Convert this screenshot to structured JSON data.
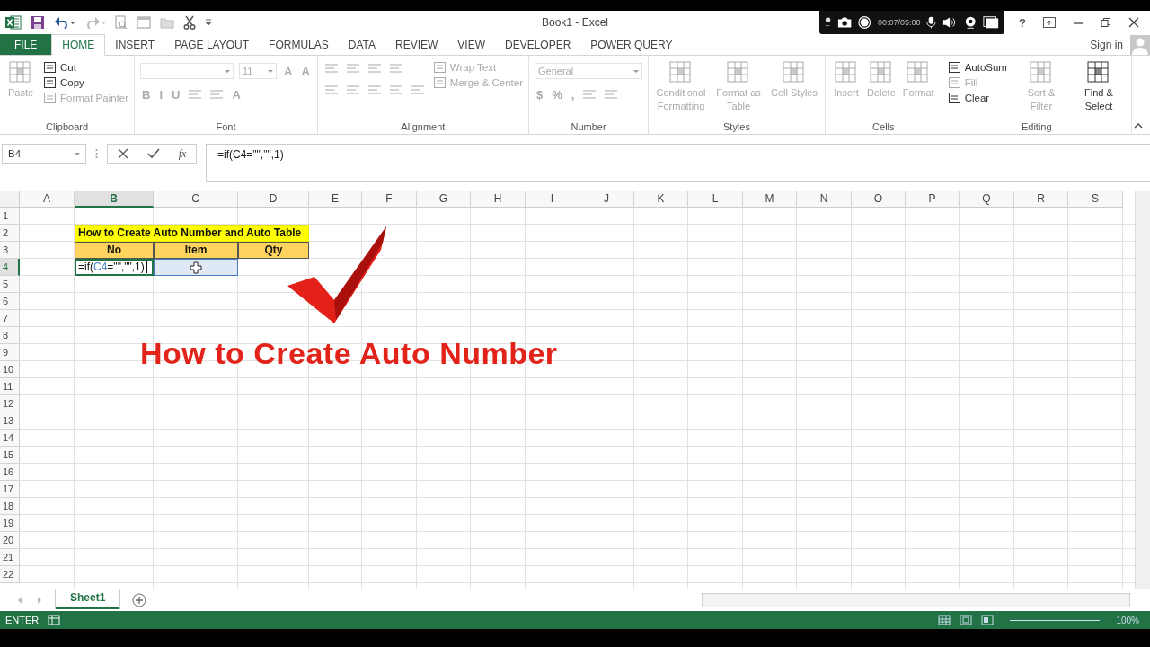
{
  "title_bar": {
    "title": "Book1 - Excel",
    "help": "?"
  },
  "recorder": {
    "time": "00:07/05:00"
  },
  "tabs": [
    {
      "label": "FILE",
      "kind": "file",
      "selected": false
    },
    {
      "label": "HOME",
      "kind": "tab",
      "selected": true
    },
    {
      "label": "INSERT",
      "kind": "tab",
      "selected": false
    },
    {
      "label": "PAGE LAYOUT",
      "kind": "tab",
      "selected": false
    },
    {
      "label": "FORMULAS",
      "kind": "tab",
      "selected": false
    },
    {
      "label": "DATA",
      "kind": "tab",
      "selected": false
    },
    {
      "label": "REVIEW",
      "kind": "tab",
      "selected": false
    },
    {
      "label": "VIEW",
      "kind": "tab",
      "selected": false
    },
    {
      "label": "DEVELOPER",
      "kind": "tab",
      "selected": false
    },
    {
      "label": "POWER QUERY",
      "kind": "tab",
      "selected": false
    }
  ],
  "sign_in": "Sign in",
  "ribbon": {
    "groups": [
      {
        "label": "Clipboard",
        "sections": [
          {
            "kind": "large",
            "items": [
              {
                "label": "Paste",
                "disabled": true
              }
            ]
          },
          {
            "kind": "stack",
            "items": [
              {
                "label": "Cut",
                "disabled": false
              },
              {
                "label": "Copy",
                "disabled": false
              },
              {
                "label": "Format Painter",
                "disabled": true
              }
            ]
          }
        ]
      },
      {
        "label": "Font",
        "sections": [
          {
            "kind": "rows",
            "rows": [
              [
                {
                  "kind": "fontbox",
                  "disabled": true
                },
                {
                  "kind": "sizebox",
                  "value": "11",
                  "disabled": true
                },
                {
                  "kind": "glyph",
                  "value": "A",
                  "disabled": true
                },
                {
                  "kind": "glyph",
                  "value": "A",
                  "disabled": true
                }
              ],
              [
                {
                  "kind": "glyph",
                  "value": "B",
                  "disabled": true
                },
                {
                  "kind": "glyph",
                  "value": "I",
                  "disabled": true
                },
                {
                  "kind": "glyph",
                  "value": "U",
                  "disabled": true
                },
                {
                  "kind": "tool",
                  "disabled": true
                },
                {
                  "kind": "tool",
                  "disabled": true
                },
                {
                  "kind": "glyph",
                  "value": "A",
                  "disabled": true
                }
              ]
            ]
          }
        ]
      },
      {
        "label": "Alignment",
        "sections": [
          {
            "kind": "rows",
            "rows": [
              [
                {
                  "kind": "tool",
                  "disabled": true
                },
                {
                  "kind": "tool",
                  "disabled": true
                },
                {
                  "kind": "tool",
                  "disabled": true
                },
                {
                  "kind": "tool",
                  "disabled": true
                }
              ],
              [
                {
                  "kind": "tool",
                  "disabled": true
                },
                {
                  "kind": "tool",
                  "disabled": true
                },
                {
                  "kind": "tool",
                  "disabled": true
                },
                {
                  "kind": "tool",
                  "disabled": true
                },
                {
                  "kind": "tool",
                  "disabled": true
                }
              ]
            ]
          },
          {
            "kind": "stack",
            "items": [
              {
                "label": "Wrap Text",
                "disabled": true
              },
              {
                "label": "Merge & Center",
                "disabled": true
              }
            ]
          }
        ]
      },
      {
        "label": "Number",
        "sections": [
          {
            "kind": "rows",
            "rows": [
              [
                {
                  "kind": "numberbox",
                  "value": "General",
                  "disabled": true
                }
              ],
              [
                {
                  "kind": "glyph",
                  "value": "$",
                  "disabled": true
                },
                {
                  "kind": "glyph",
                  "value": "%",
                  "disabled": true
                },
                {
                  "kind": "glyph",
                  "value": ",",
                  "disabled": true
                },
                {
                  "kind": "tool",
                  "disabled": true
                },
                {
                  "kind": "tool",
                  "disabled": true
                }
              ]
            ]
          }
        ]
      },
      {
        "label": "Styles",
        "sections": [
          {
            "kind": "large",
            "items": [
              {
                "label": "Conditional Formatting",
                "disabled": true
              },
              {
                "label": "Format as Table",
                "disabled": true
              },
              {
                "label": "Cell Styles",
                "disabled": true
              }
            ]
          }
        ]
      },
      {
        "label": "Cells",
        "sections": [
          {
            "kind": "large",
            "items": [
              {
                "label": "Insert",
                "disabled": true
              },
              {
                "label": "Delete",
                "disabled": true
              },
              {
                "label": "Format",
                "disabled": true
              }
            ]
          }
        ]
      },
      {
        "label": "Editing",
        "sections": [
          {
            "kind": "stack",
            "items": [
              {
                "label": "AutoSum",
                "disabled": false
              },
              {
                "label": "Fill",
                "disabled": true
              },
              {
                "label": "Clear",
                "disabled": false
              }
            ]
          },
          {
            "kind": "large",
            "items": [
              {
                "label": "Sort & Filter",
                "disabled": true
              },
              {
                "label": "Find & Select",
                "disabled": false
              }
            ]
          }
        ]
      }
    ]
  },
  "formula_bar": {
    "name_box": "B4",
    "fx": "fx",
    "formula": "=if(C4=\"\",\"\",1)"
  },
  "sheet": {
    "columns": [
      {
        "label": "A",
        "selected": false
      },
      {
        "label": "B",
        "selected": true
      },
      {
        "label": "C",
        "selected": false
      },
      {
        "label": "D",
        "selected": false
      },
      {
        "label": "E",
        "selected": false
      },
      {
        "label": "F",
        "selected": false
      },
      {
        "label": "G",
        "selected": false
      },
      {
        "label": "H",
        "selected": false
      },
      {
        "label": "I",
        "selected": false
      },
      {
        "label": "J",
        "selected": false
      },
      {
        "label": "K",
        "selected": false
      },
      {
        "label": "L",
        "selected": false
      },
      {
        "label": "M",
        "selected": false
      },
      {
        "label": "N",
        "selected": false
      },
      {
        "label": "O",
        "selected": false
      },
      {
        "label": "P",
        "selected": false
      },
      {
        "label": "Q",
        "selected": false
      },
      {
        "label": "R",
        "selected": false
      },
      {
        "label": "S",
        "selected": false
      }
    ],
    "rows": [
      {
        "label": "1",
        "selected": false
      },
      {
        "label": "2",
        "selected": false
      },
      {
        "label": "3",
        "selected": false
      },
      {
        "label": "4",
        "selected": true
      },
      {
        "label": "5",
        "selected": false
      },
      {
        "label": "6",
        "selected": false
      },
      {
        "label": "7",
        "selected": false
      },
      {
        "label": "8",
        "selected": false
      },
      {
        "label": "9",
        "selected": false
      },
      {
        "label": "10",
        "selected": false
      },
      {
        "label": "11",
        "selected": false
      },
      {
        "label": "12",
        "selected": false
      },
      {
        "label": "13",
        "selected": false
      },
      {
        "label": "14",
        "selected": false
      },
      {
        "label": "15",
        "selected": false
      },
      {
        "label": "16",
        "selected": false
      },
      {
        "label": "17",
        "selected": false
      },
      {
        "label": "18",
        "selected": false
      },
      {
        "label": "19",
        "selected": false
      },
      {
        "label": "20",
        "selected": false
      },
      {
        "label": "21",
        "selected": false
      },
      {
        "label": "22",
        "selected": false
      }
    ],
    "table": {
      "title": "How to Create Auto Number and Auto Table",
      "headers": [
        "No",
        "Item",
        "Qty"
      ],
      "rows": [
        [
          {
            "kind": "editing",
            "parts": [
              {
                "kind": "plain",
                "text": "=if("
              },
              {
                "kind": "reference",
                "text": "C4"
              },
              {
                "kind": "plain",
                "text": "=\"\",\"\",1)"
              }
            ]
          },
          {
            "kind": "referenced"
          },
          {
            "kind": "empty"
          }
        ]
      ]
    }
  },
  "overlay": {
    "caption": "How to Create Auto Number"
  },
  "sheet_tabs": [
    {
      "label": "Sheet1",
      "selected": true
    }
  ],
  "status_bar": {
    "mode": "ENTER",
    "zoom": "100%"
  }
}
